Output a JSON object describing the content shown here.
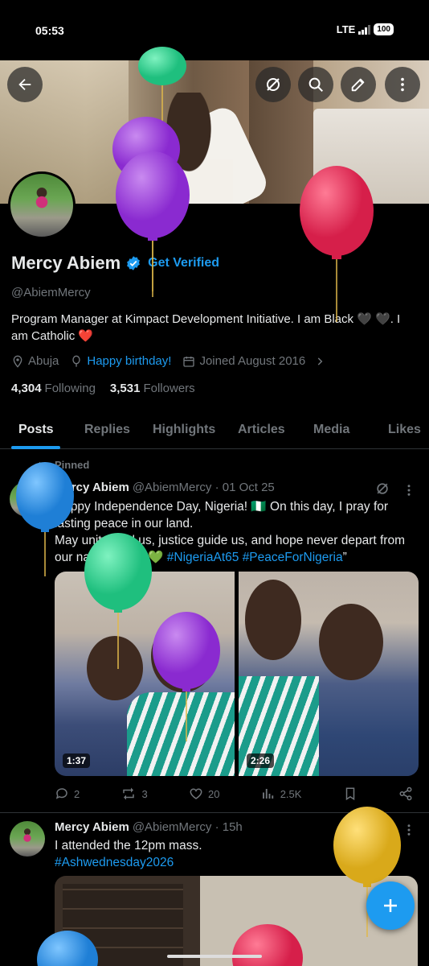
{
  "status_bar": {
    "time": "05:53",
    "network": "LTE",
    "battery": "100"
  },
  "header": {
    "back_icon": "arrow-left-icon",
    "actions": [
      "grok-icon",
      "search-icon",
      "edit-icon",
      "more-vertical-icon"
    ]
  },
  "profile": {
    "name": "Mercy Abiem",
    "get_verified": "Get Verified",
    "handle": "@AbiemMercy",
    "bio": "Program Manager at Kimpact Development Initiative. I am Black 🖤 🖤. I am Catholic ❤️",
    "location": "Abuja",
    "birthday": "Happy birthday!",
    "joined": "Joined August 2016",
    "following_count": "4,304",
    "following_label": "Following",
    "followers_count": "3,531",
    "followers_label": "Followers"
  },
  "tabs": [
    "Posts",
    "Replies",
    "Highlights",
    "Articles",
    "Media",
    "Likes"
  ],
  "tweets": [
    {
      "pinned_label": "Pinned",
      "author": "Mercy Abiem",
      "handle": "@AbiemMercy",
      "time": "· 01 Oct 25",
      "text_line1": "Happy Independence Day, Nigeria! 🇳🇬 On this day, I pray for lasting peace in our land.",
      "text_line2": "May unity bind us, justice guide us, and hope never depart from our nation. 💚🤍💚 ",
      "hashtag1": "#NigeriaAt65",
      "hashtag2": "#PeaceForNigeria",
      "text_end": "”",
      "media": [
        {
          "duration": "1:37"
        },
        {
          "duration": "2:26"
        }
      ],
      "stats": {
        "replies": "2",
        "reposts": "3",
        "likes": "20",
        "views": "2.5K"
      }
    },
    {
      "author": "Mercy Abiem",
      "handle": "@AbiemMercy",
      "time": "· 15h",
      "text": "I attended the 12pm mass.",
      "hashtag": "#Ashwednesday2026"
    }
  ],
  "colors": {
    "accent": "#1d9bf0",
    "background": "#000000",
    "secondary_text": "#71767b"
  },
  "balloons": [
    "green",
    "purple",
    "purple",
    "red",
    "blue",
    "green",
    "purple",
    "yellow",
    "blue",
    "red"
  ]
}
